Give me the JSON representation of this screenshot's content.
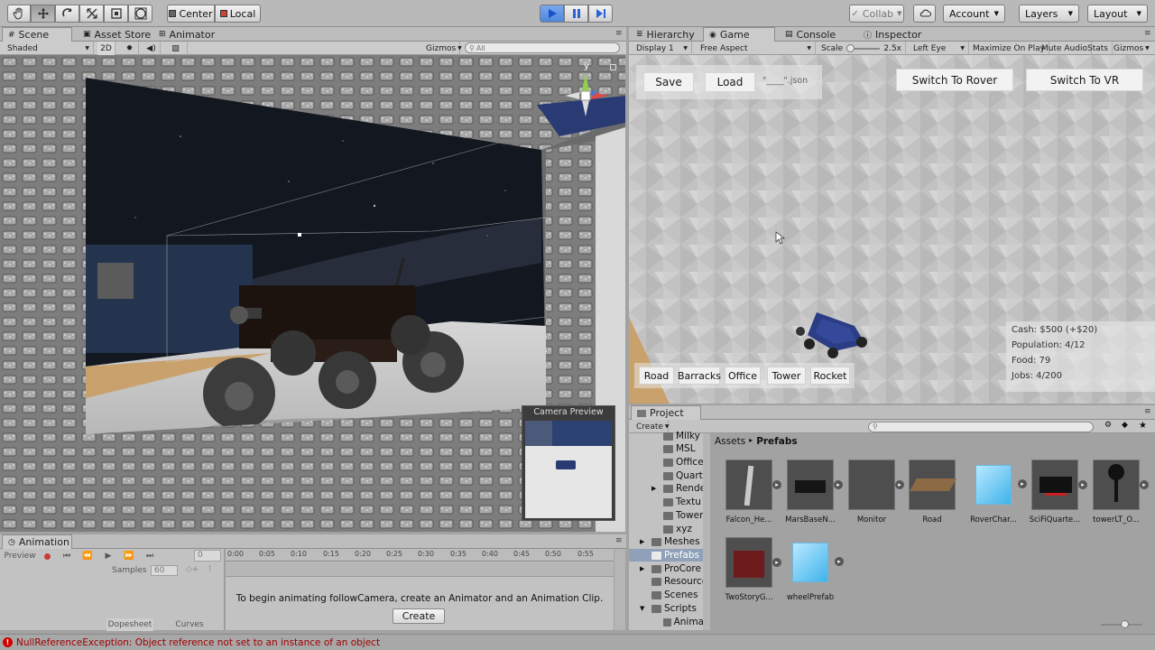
{
  "toolbar": {
    "pivot_label": "Center",
    "space_label": "Local",
    "collab_label": "Collab",
    "account_label": "Account",
    "layers_label": "Layers",
    "layout_label": "Layout"
  },
  "left_tabs": {
    "scene": "Scene",
    "asset_store": "Asset Store",
    "animator": "Animator"
  },
  "scene_bar": {
    "shading": "Shaded",
    "mode_2d": "2D",
    "gizmos": "Gizmos",
    "search_placeholder": "All"
  },
  "scene_view": {
    "axis_label": "y",
    "camera_preview_title": "Camera Preview"
  },
  "right_tabs": {
    "hierarchy": "Hierarchy",
    "game": "Game",
    "console": "Console",
    "inspector": "Inspector"
  },
  "game_bar": {
    "display": "Display 1",
    "aspect": "Free Aspect",
    "scale_label": "Scale",
    "scale_value": "2.5x",
    "eye": "Left Eye",
    "maximize": "Maximize On Play",
    "mute": "Mute Audio",
    "stats": "Stats",
    "gizmos": "Gizmos"
  },
  "game_gui": {
    "save": "Save",
    "load": "Load",
    "file_field": "\"____\".json",
    "switch_rover": "Switch To Rover",
    "switch_vr": "Switch To VR",
    "build_buttons": [
      "Road",
      "Barracks",
      "Office",
      "Tower",
      "Rocket"
    ],
    "stats": [
      "Cash: $500 (+$20)",
      "Population: 4/12",
      "Food: 79",
      "Jobs: 4/200"
    ]
  },
  "project": {
    "title": "Project",
    "create": "Create",
    "breadcrumb_root": "Assets",
    "breadcrumb_current": "Prefabs",
    "tree": [
      "Milky",
      "MSL",
      "Office",
      "Quart",
      "Rende",
      "Textu",
      "Tower",
      "xyz",
      "Meshes",
      "Prefabs",
      "ProCore",
      "Resource",
      "Scenes",
      "Scripts",
      "Anima"
    ],
    "assets_row1": [
      "Falcon_He...",
      "MarsBaseN...",
      "Monitor",
      "Road",
      "RoverChar...",
      "SciFiQuarte...",
      "towerLT_O..."
    ],
    "assets_row2": [
      "TwoStoryG...",
      "wheelPrefab"
    ]
  },
  "animation": {
    "title": "Animation",
    "preview": "Preview",
    "samples_label": "Samples",
    "samples_value": "60",
    "frame_value": "0",
    "timeline_ticks": [
      "0:00",
      "0:05",
      "0:10",
      "0:15",
      "0:20",
      "0:25",
      "0:30",
      "0:35",
      "0:40",
      "0:45",
      "0:50",
      "0:55"
    ],
    "message": "To begin animating followCamera, create an Animator and an Animation Clip.",
    "create": "Create",
    "dopesheet": "Dopesheet",
    "curves": "Curves"
  },
  "status": {
    "error": "NullReferenceException: Object reference not set to an instance of an object"
  },
  "colors": {
    "accent_blue": "#3b7fe8",
    "error_red": "#d40000"
  }
}
